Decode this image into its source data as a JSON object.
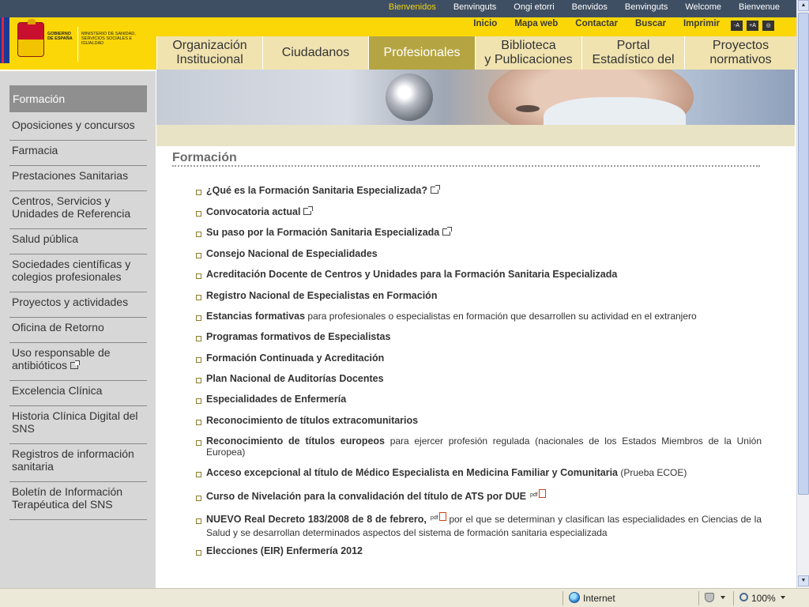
{
  "language_bar": {
    "items": [
      {
        "label": "Bienvenidos",
        "active": true
      },
      {
        "label": "Benvinguts",
        "active": false
      },
      {
        "label": "Ongi etorri",
        "active": false
      },
      {
        "label": "Benvidos",
        "active": false
      },
      {
        "label": "Benvinguts",
        "active": false
      },
      {
        "label": "Welcome",
        "active": false
      },
      {
        "label": "Bienvenue",
        "active": false
      }
    ]
  },
  "logo": {
    "gobierno_text": "GOBIERNO DE ESPAÑA",
    "ministerio_text": "MINISTERIO DE SANIDAD, SERVICIOS SOCIALES E IGUALDAD"
  },
  "utility_nav": {
    "links": [
      "Inicio",
      "Mapa web",
      "Contactar",
      "Buscar",
      "Imprimir"
    ],
    "accessibility": [
      "-A",
      "+A",
      "◎"
    ]
  },
  "main_nav": {
    "tabs": [
      {
        "label": "Organización\nInstitucional",
        "active": false
      },
      {
        "label": "Ciudadanos",
        "active": false
      },
      {
        "label": "Profesionales",
        "active": true
      },
      {
        "label": "Biblioteca\ny Publicaciones",
        "active": false
      },
      {
        "label": "Portal\nEstadístico del",
        "active": false
      },
      {
        "label": "Proyectos\nnormativos",
        "active": false
      }
    ]
  },
  "sidebar": {
    "active": "Formación",
    "items": [
      "Oposiciones y concursos",
      "Farmacia",
      "Prestaciones Sanitarias",
      "Centros, Servicios y\nUnidades de Referencia",
      "Salud pública",
      "Sociedades científicas y\ncolegios profesionales",
      "Proyectos y actividades",
      "Oficina de Retorno",
      "Uso responsable de\nantibióticos",
      "Excelencia Clínica",
      "Historia Clínica Digital del\nSNS",
      "Registros de información\nsanitaria",
      "Boletín de Información\nTerapéutica del SNS"
    ]
  },
  "content": {
    "title": "Formación",
    "items": [
      {
        "bold": "¿Qué es la Formación Sanitaria Especializada?",
        "rest": "",
        "icon": "external-link-icon"
      },
      {
        "bold": "Convocatoria actual",
        "rest": "",
        "icon": "external-link-icon"
      },
      {
        "bold": "Su paso por la Formación Sanitaria Especializada",
        "rest": "",
        "icon": "external-link-icon"
      },
      {
        "bold": "Consejo Nacional de Especialidades",
        "rest": "",
        "icon": ""
      },
      {
        "bold": "Acreditación Docente de Centros y Unidades para la Formación Sanitaria Especializada",
        "rest": "",
        "icon": ""
      },
      {
        "bold": "Registro Nacional de Especialistas en Formación",
        "rest": "",
        "icon": ""
      },
      {
        "bold": "Estancias formativas",
        "rest": " para profesionales o especialistas en formación que desarrollen su actividad en el extranjero",
        "icon": ""
      },
      {
        "bold": "Programas formativos de Especialistas",
        "rest": "",
        "icon": ""
      },
      {
        "bold": "Formación Continuada y Acreditación",
        "rest": "",
        "icon": ""
      },
      {
        "bold": "Plan Nacional de Auditorías Docentes",
        "rest": "",
        "icon": ""
      },
      {
        "bold": "Especialidades de Enfermería",
        "rest": "",
        "icon": ""
      },
      {
        "bold": "Reconocimiento de títulos extracomunitarios",
        "rest": "",
        "icon": ""
      },
      {
        "bold": "Reconocimiento de títulos europeos",
        "rest": " para ejercer profesión regulada (nacionales de los Estados Miembros de la Unión Europea)",
        "icon": ""
      },
      {
        "bold": "Acceso excepcional al título de Médico Especialista en Medicina Familiar y Comunitaria",
        "rest": " (Prueba ECOE)",
        "icon": ""
      },
      {
        "bold": "Curso de Nivelación para la convalidación del título de ATS por DUE",
        "rest": "",
        "icon": "pdf-icon"
      },
      {
        "bold": "NUEVO Real Decreto 183/2008 de 8 de febrero,",
        "rest": " por el que se determinan y clasifican las especialidades en Ciencias de la Salud y se desarrollan determinados aspectos del sistema de formación sanitaria especializada",
        "icon": "pdf-icon-inline"
      },
      {
        "bold": "Elecciones (EIR) Enfermería 2012",
        "rest": "",
        "icon": ""
      }
    ],
    "pdf_label": "pdf"
  },
  "statusbar": {
    "zone": "Internet",
    "zoom": "100%"
  }
}
